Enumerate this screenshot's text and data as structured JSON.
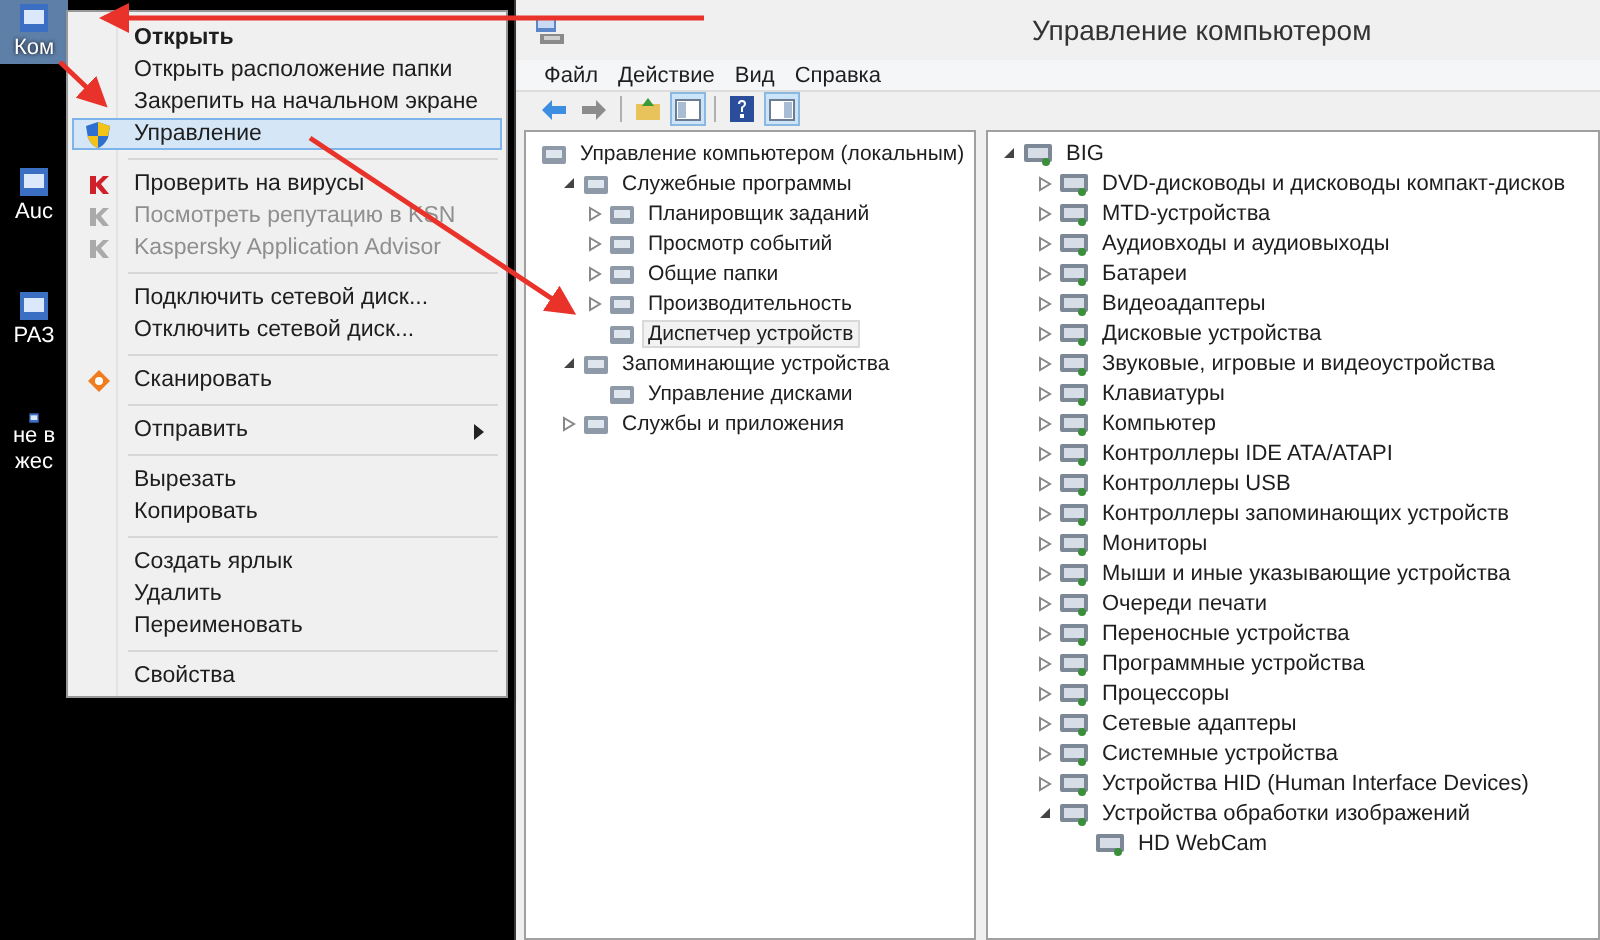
{
  "desktop": {
    "icons": [
      {
        "lines": [
          "Ком"
        ],
        "selected": true
      },
      {
        "lines": [
          "Auc"
        ],
        "selected": false
      },
      {
        "lines": [
          "РАЗ"
        ],
        "selected": false
      },
      {
        "lines": [
          "не в",
          "жес"
        ],
        "selected": false
      }
    ]
  },
  "context_menu": {
    "items": [
      {
        "kind": "plain",
        "label": "Открыть",
        "default": true,
        "disabled": false,
        "selected": false
      },
      {
        "kind": "plain",
        "label": "Открыть расположение папки",
        "default": false,
        "disabled": false,
        "selected": false
      },
      {
        "kind": "plain",
        "label": "Закрепить на начальном экране",
        "default": false,
        "disabled": false,
        "selected": false
      },
      {
        "kind": "shield",
        "label": "Управление",
        "default": false,
        "disabled": false,
        "selected": true
      },
      {
        "kind": "separator"
      },
      {
        "kind": "kaspersky",
        "label": "Проверить на вирусы",
        "default": false,
        "disabled": false,
        "selected": false
      },
      {
        "kind": "kaspersky",
        "label": "Посмотреть репутацию в KSN",
        "default": false,
        "disabled": true,
        "selected": false
      },
      {
        "kind": "kaspersky",
        "label": "Kaspersky Application Advisor",
        "default": false,
        "disabled": true,
        "selected": false
      },
      {
        "kind": "separator"
      },
      {
        "kind": "plain",
        "label": "Подключить сетевой диск...",
        "default": false,
        "disabled": false,
        "selected": false
      },
      {
        "kind": "plain",
        "label": "Отключить сетевой диск...",
        "default": false,
        "disabled": false,
        "selected": false
      },
      {
        "kind": "separator"
      },
      {
        "kind": "scan",
        "label": "Сканировать",
        "default": false,
        "disabled": false,
        "selected": false
      },
      {
        "kind": "separator"
      },
      {
        "kind": "submenu",
        "label": "Отправить",
        "default": false,
        "disabled": false,
        "selected": false
      },
      {
        "kind": "separator"
      },
      {
        "kind": "plain",
        "label": "Вырезать",
        "default": false,
        "disabled": false,
        "selected": false
      },
      {
        "kind": "plain",
        "label": "Копировать",
        "default": false,
        "disabled": false,
        "selected": false
      },
      {
        "kind": "separator"
      },
      {
        "kind": "plain",
        "label": "Создать ярлык",
        "default": false,
        "disabled": false,
        "selected": false
      },
      {
        "kind": "plain",
        "label": "Удалить",
        "default": false,
        "disabled": false,
        "selected": false
      },
      {
        "kind": "plain",
        "label": "Переименовать",
        "default": false,
        "disabled": false,
        "selected": false
      },
      {
        "kind": "separator"
      },
      {
        "kind": "plain",
        "label": "Свойства",
        "default": false,
        "disabled": false,
        "selected": false
      }
    ]
  },
  "window": {
    "title": "Управление компьютером"
  },
  "menu_bar": [
    "Файл",
    "Действие",
    "Вид",
    "Справка"
  ],
  "toolbar": [
    {
      "kind": "back",
      "pressed": false
    },
    {
      "kind": "forward",
      "pressed": false
    },
    {
      "kind": "separator"
    },
    {
      "kind": "up",
      "pressed": false
    },
    {
      "kind": "tree",
      "pressed": true
    },
    {
      "kind": "separator"
    },
    {
      "kind": "help",
      "pressed": false
    },
    {
      "kind": "pane",
      "pressed": true
    }
  ],
  "left_tree": [
    {
      "label": "Управление компьютером (локальным)",
      "selected": false,
      "children": [
        {
          "label": "Служебные программы",
          "expanded": true,
          "selected": false,
          "children": [
            {
              "label": "Планировщик заданий",
              "expanded": false,
              "selected": false
            },
            {
              "label": "Просмотр событий",
              "expanded": false,
              "selected": false
            },
            {
              "label": "Общие папки",
              "expanded": false,
              "selected": false
            },
            {
              "label": "Производительность",
              "expanded": false,
              "selected": false
            },
            {
              "label": "Диспетчер устройств",
              "selected": true
            }
          ]
        },
        {
          "label": "Запоминающие устройства",
          "expanded": true,
          "selected": false,
          "children": [
            {
              "label": "Управление дисками",
              "selected": false
            }
          ]
        },
        {
          "label": "Службы и приложения",
          "expanded": false,
          "selected": false
        }
      ]
    }
  ],
  "device_tree": [
    {
      "label": "BIG",
      "expanded": true,
      "children": [
        {
          "label": "DVD-дисководы и дисководы компакт-дисков",
          "expanded": false
        },
        {
          "label": "MTD-устройства",
          "expanded": false
        },
        {
          "label": "Аудиовходы и аудиовыходы",
          "expanded": false
        },
        {
          "label": "Батареи",
          "expanded": false
        },
        {
          "label": "Видеоадаптеры",
          "expanded": false
        },
        {
          "label": "Дисковые устройства",
          "expanded": false
        },
        {
          "label": "Звуковые, игровые и видеоустройства",
          "expanded": false
        },
        {
          "label": "Клавиатуры",
          "expanded": false
        },
        {
          "label": "Компьютер",
          "expanded": false
        },
        {
          "label": "Контроллеры IDE ATA/ATAPI",
          "expanded": false
        },
        {
          "label": "Контроллеры USB",
          "expanded": false
        },
        {
          "label": "Контроллеры запоминающих устройств",
          "expanded": false
        },
        {
          "label": "Мониторы",
          "expanded": false
        },
        {
          "label": "Мыши и иные указывающие устройства",
          "expanded": false
        },
        {
          "label": "Очереди печати",
          "expanded": false
        },
        {
          "label": "Переносные устройства",
          "expanded": false
        },
        {
          "label": "Программные устройства",
          "expanded": false
        },
        {
          "label": "Процессоры",
          "expanded": false
        },
        {
          "label": "Сетевые адаптеры",
          "expanded": false
        },
        {
          "label": "Системные устройства",
          "expanded": false
        },
        {
          "label": "Устройства HID (Human Interface Devices)",
          "expanded": false
        },
        {
          "label": "Устройства обработки изображений",
          "expanded": true,
          "children": [
            {
              "label": "HD WebCam"
            }
          ]
        }
      ]
    }
  ]
}
